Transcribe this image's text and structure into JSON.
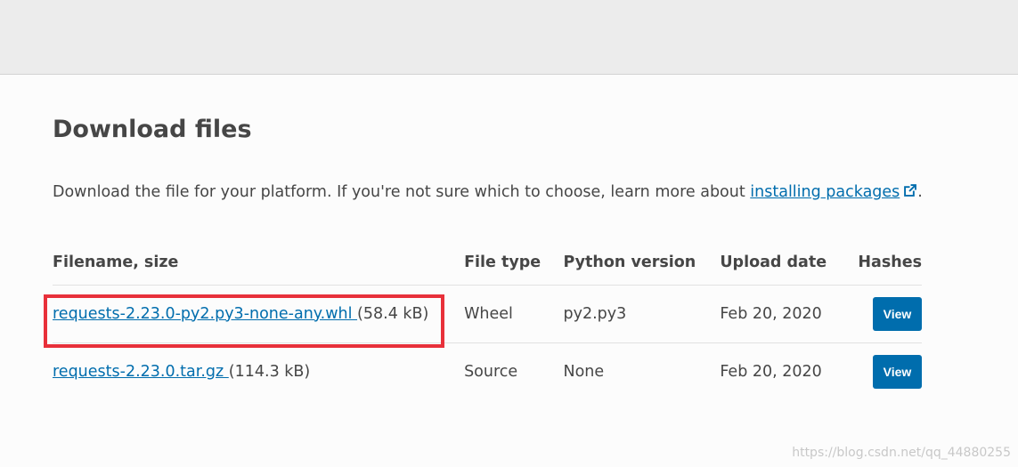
{
  "section_title": "Download files",
  "intro": {
    "text_before": "Download the file for your platform. If you're not sure which to choose, learn more about ",
    "link_text": "installing packages",
    "text_after": "."
  },
  "table": {
    "headers": [
      "Filename, size",
      "File type",
      "Python version",
      "Upload date",
      "Hashes"
    ],
    "rows": [
      {
        "filename": "requests-2.23.0-py2.py3-none-any.whl ",
        "size": "(58.4 kB)",
        "file_type": "Wheel",
        "python_version": "py2.py3",
        "upload_date": "Feb 20, 2020",
        "hashes_button": "View"
      },
      {
        "filename": "requests-2.23.0.tar.gz ",
        "size": "(114.3 kB)",
        "file_type": "Source",
        "python_version": "None",
        "upload_date": "Feb 20, 2020",
        "hashes_button": "View"
      }
    ]
  },
  "watermark": "https://blog.csdn.net/qq_44880255",
  "colors": {
    "link": "#006dad",
    "button": "#006dad",
    "highlight_box": "#e8303a",
    "header_bar": "#ececec"
  }
}
